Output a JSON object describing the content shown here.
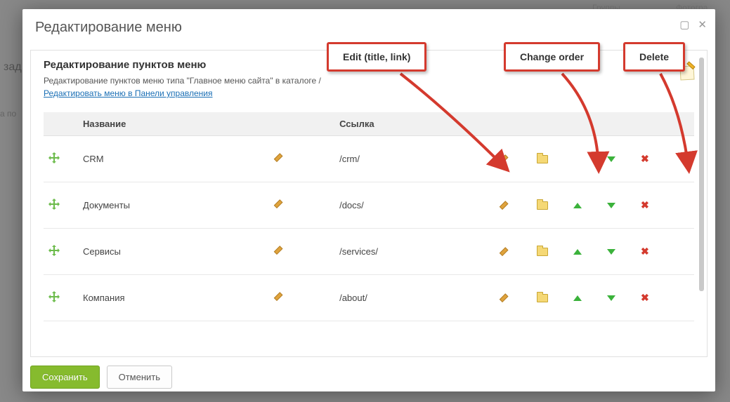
{
  "dialog": {
    "title": "Редактирование меню"
  },
  "panel": {
    "heading": "Редактирование пунктов меню",
    "subtext": "Редактирование пунктов меню типа \"Главное меню сайта\" в каталоге /",
    "link_text": "Редактировать меню в Панели управления"
  },
  "table": {
    "col_name": "Название",
    "col_link": "Ссылка",
    "rows": [
      {
        "name": "CRM",
        "link": "/crm/",
        "can_up": false,
        "can_down": true
      },
      {
        "name": "Документы",
        "link": "/docs/",
        "can_up": true,
        "can_down": true
      },
      {
        "name": "Сервисы",
        "link": "/services/",
        "can_up": true,
        "can_down": true
      },
      {
        "name": "Компания",
        "link": "/about/",
        "can_up": true,
        "can_down": true
      }
    ]
  },
  "footer": {
    "save": "Сохранить",
    "cancel": "Отменить"
  },
  "callouts": {
    "edit": "Edit (title, link)",
    "order": "Change order",
    "delete": "Delete"
  }
}
